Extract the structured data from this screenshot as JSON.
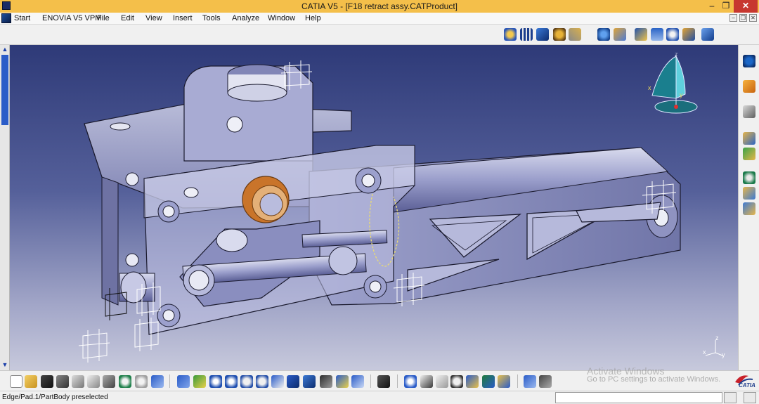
{
  "window": {
    "title": "CATIA V5 - [F18 retract assy.CATProduct]",
    "controls": {
      "minimize": "–",
      "maximize": "❐",
      "close": "✕"
    }
  },
  "menubar": {
    "items": [
      {
        "label": "Start"
      },
      {
        "label": "ENOVIA V5 VPM"
      },
      {
        "label": "File"
      },
      {
        "label": "Edit"
      },
      {
        "label": "View"
      },
      {
        "label": "Insert"
      },
      {
        "label": "Tools"
      },
      {
        "label": "Analyze"
      },
      {
        "label": "Window"
      },
      {
        "label": "Help"
      }
    ],
    "doc_controls": {
      "minimize": "–",
      "restore": "❐",
      "close": "✕"
    }
  },
  "compass": {
    "x_label": "x",
    "y_label": "y",
    "z_label": "z"
  },
  "axis_triad": {
    "x_label": "x",
    "y_label": "y",
    "z_label": "z"
  },
  "watermark": {
    "line1": "Activate Windows",
    "line2": "Go to PC settings to activate Windows."
  },
  "brand": {
    "logo_text": "CATIA"
  },
  "statusbar": {
    "status_text": "Edge/Pad.1/PartBody preselected",
    "command_value": ""
  },
  "colors": {
    "titlebar": "#f4bf4a",
    "viewport_top": "#2e3a78",
    "viewport_bottom": "#c7c9dc",
    "part_fill": "#8d91c2",
    "bushing": "#d07c2b"
  }
}
